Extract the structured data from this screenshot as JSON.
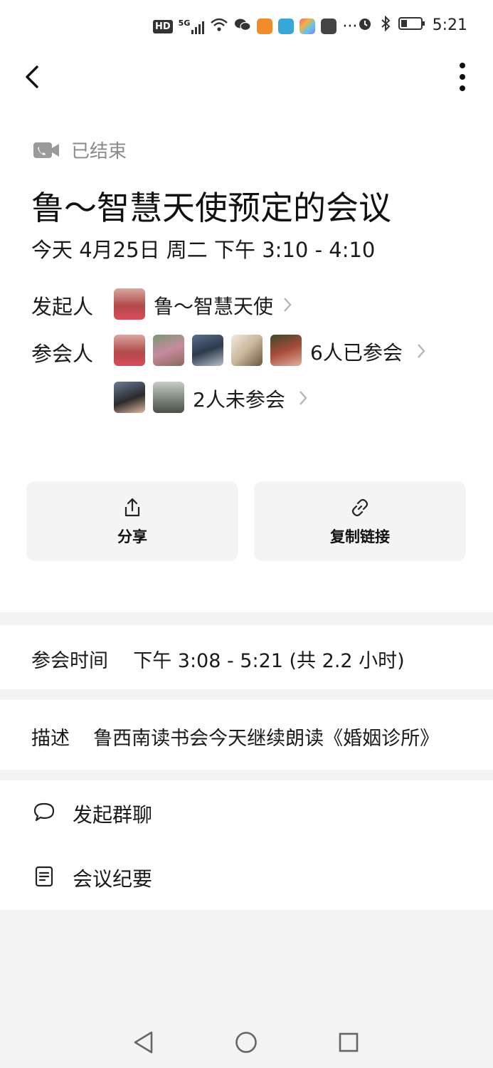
{
  "status_bar": {
    "network_label": "HD",
    "signal_label": "5G",
    "more_dots": "···",
    "time": "5:21"
  },
  "header": {
    "back_icon": "chevron-left-icon",
    "more_icon": "more-vertical-icon"
  },
  "meeting": {
    "status": "已结束",
    "title": "鲁～智慧天使预定的会议",
    "datetime": "今天 4月25日 周二 下午 3:10 - 4:10",
    "organizer_label": "发起人",
    "organizer_name": "鲁～智慧天使",
    "attendees_label": "参会人",
    "joined_text": "6人已参会",
    "not_joined_text": "2人未参会"
  },
  "actions": {
    "share_label": "分享",
    "copy_link_label": "复制链接"
  },
  "details": {
    "attend_time_label": "参会时间",
    "attend_time_value": "下午 3:08 - 5:21 (共 2.2 小时)",
    "description_label": "描述",
    "description_value": "鲁西南读书会今天继续朗读《婚姻诊所》"
  },
  "list": {
    "group_chat_label": "发起群聊",
    "minutes_label": "会议纪要"
  },
  "colors": {
    "accent_gray": "#8a8a8a",
    "card_bg": "#f4f4f4",
    "divider_bg": "#f3f3f3"
  }
}
